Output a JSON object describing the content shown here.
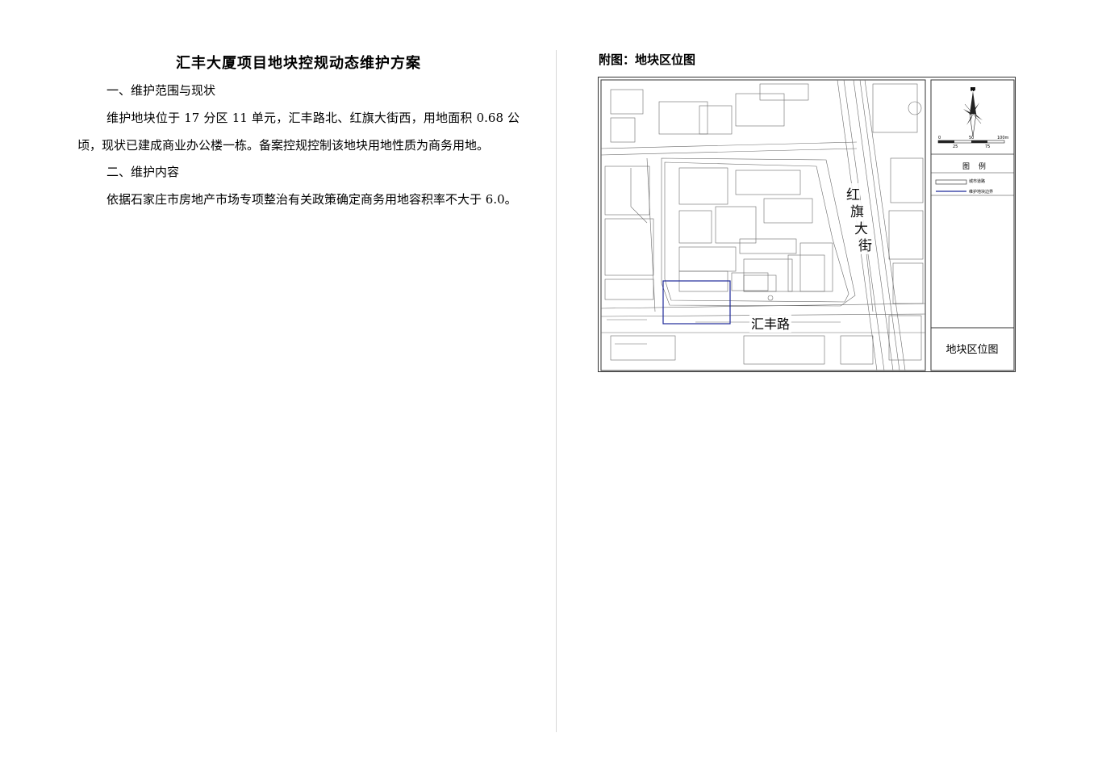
{
  "document": {
    "title": "汇丰大厦项目地块控规动态维护方案",
    "section1_heading": "一、维护范围与现状",
    "section1_body": "维护地块位于 17 分区 11 单元，汇丰路北、红旗大街西，用地面积 0.68 公顷，现状已建成商业办公楼一栋。备案控规控制该地块用地性质为商务用地。",
    "section2_heading": "二、维护内容",
    "section2_body": "依据石家庄市房地产市场专项整治有关政策确定商务用地容积率不大于 6.0。"
  },
  "map": {
    "caption": "附图：地块区位图",
    "panel_caption": "地块区位图",
    "street_vertical": [
      "红",
      "旗",
      "大",
      "街"
    ],
    "road_horizontal": "汇丰路",
    "north_label": "N",
    "scale_labels": [
      "0",
      "50",
      "100m",
      "25",
      "75"
    ],
    "legend_title": "图 例",
    "legend_items": [
      {
        "label": "城市道路",
        "color": "#555555"
      },
      {
        "label": "维护地块边界",
        "color": "#1f2a9a"
      }
    ],
    "colors": {
      "boundary": "#1f2a9a",
      "linework": "#6b6b6b"
    }
  }
}
